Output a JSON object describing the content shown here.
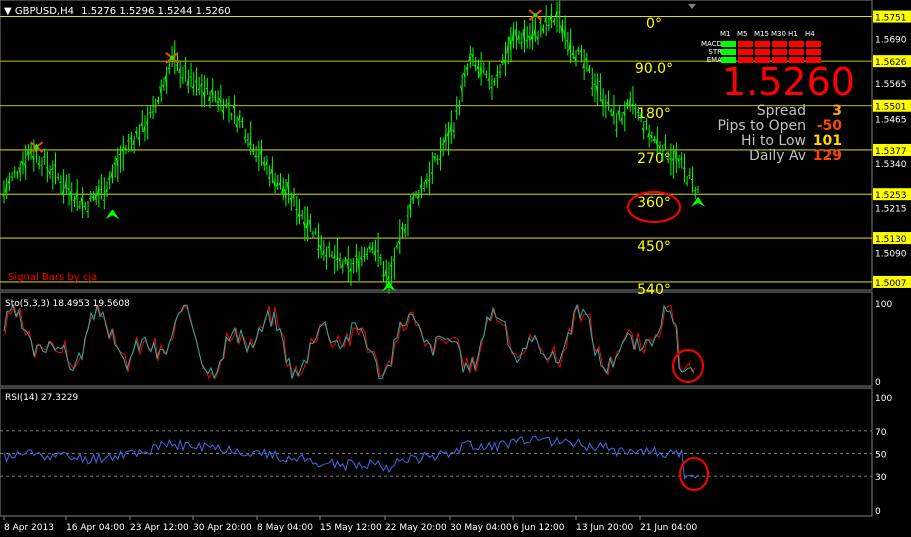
{
  "header": {
    "symbol": "GBPUSD,H4",
    "ohlc": "1.5276 1.5296 1.5244 1.5260"
  },
  "price_panel": {
    "levels": [
      "1.5751",
      "1.5626",
      "1.5501",
      "1.5377",
      "1.5253",
      "1.5130",
      "1.5007"
    ],
    "axis_ticks": [
      "1.5690",
      "1.5565",
      "1.5465",
      "1.5340",
      "1.5215",
      "1.5090"
    ],
    "angles": [
      "0°",
      "90.0°",
      "180°",
      "270°",
      "360°",
      "450°",
      "540°"
    ],
    "signature": "Signal Bars by cja",
    "colors": {
      "up": "#00ff00",
      "down": "#00ff00",
      "level": "#ffff00",
      "accent": "#ff0000"
    }
  },
  "info_panel": {
    "timeframes": [
      "M1",
      "M5",
      "M15",
      "M30",
      "H1",
      "H4"
    ],
    "rows": [
      {
        "label": "MACD",
        "states": [
          "green",
          "red",
          "red",
          "red",
          "red",
          "red"
        ]
      },
      {
        "label": "STR",
        "states": [
          "green",
          "red",
          "red",
          "red",
          "red",
          "red"
        ]
      },
      {
        "label": "EMA",
        "states": [
          "green",
          "red",
          "red",
          "red",
          "red",
          "red"
        ]
      }
    ],
    "price": "1.5260",
    "stats": [
      {
        "label": "Spread",
        "value": "3",
        "color": "#ffa500"
      },
      {
        "label": "Pips to Open",
        "value": "-50",
        "color": "#ff4500"
      },
      {
        "label": "Hi to Low",
        "value": "101",
        "color": "#ffd700"
      },
      {
        "label": "Daily Av",
        "value": "129",
        "color": "#ff4500"
      }
    ]
  },
  "stoch_panel": {
    "title": "Sto(5,3,3) 18.4953 19.5608",
    "ticks": [
      "100",
      "0"
    ]
  },
  "rsi_panel": {
    "title": "RSI(14) 27.3229",
    "ticks": [
      "100",
      "70",
      "50",
      "30",
      "0"
    ]
  },
  "time_axis": [
    "8 Apr 2013",
    "16 Apr 04:00",
    "23 Apr 12:00",
    "30 Apr 20:00",
    "8 May 04:00",
    "15 May 12:00",
    "22 May 20:00",
    "30 May 04:00",
    "6 Jun 12:00",
    "13 Jun 20:00",
    "21 Jun 04:00"
  ],
  "chart_data": {
    "type": "line",
    "title": "GBPUSD,H4",
    "price_series": {
      "name": "GBPUSD",
      "x_index": [
        0,
        10,
        20,
        30,
        38,
        45,
        55,
        62,
        70,
        80,
        88,
        96,
        104,
        112,
        120,
        128,
        136,
        142,
        150,
        158,
        166,
        172,
        180,
        188,
        196,
        204,
        212,
        220,
        226,
        232,
        238,
        244,
        250,
        256
      ],
      "values": [
        1.526,
        1.538,
        1.53,
        1.522,
        1.528,
        1.538,
        1.548,
        1.563,
        1.556,
        1.552,
        1.545,
        1.534,
        1.526,
        1.518,
        1.508,
        1.504,
        1.512,
        1.501,
        1.522,
        1.532,
        1.545,
        1.563,
        1.556,
        1.569,
        1.57,
        1.575,
        1.564,
        1.554,
        1.546,
        1.55,
        1.542,
        1.538,
        1.533,
        1.526
      ]
    },
    "rsi": {
      "name": "RSI(14)",
      "last": 27.3229,
      "ylim": [
        0,
        100
      ],
      "levels": [
        70,
        50,
        30
      ]
    },
    "stochastic": {
      "name": "Sto(5,3,3)",
      "main": 18.4953,
      "signal": 19.5608,
      "ylim": [
        0,
        100
      ]
    }
  }
}
